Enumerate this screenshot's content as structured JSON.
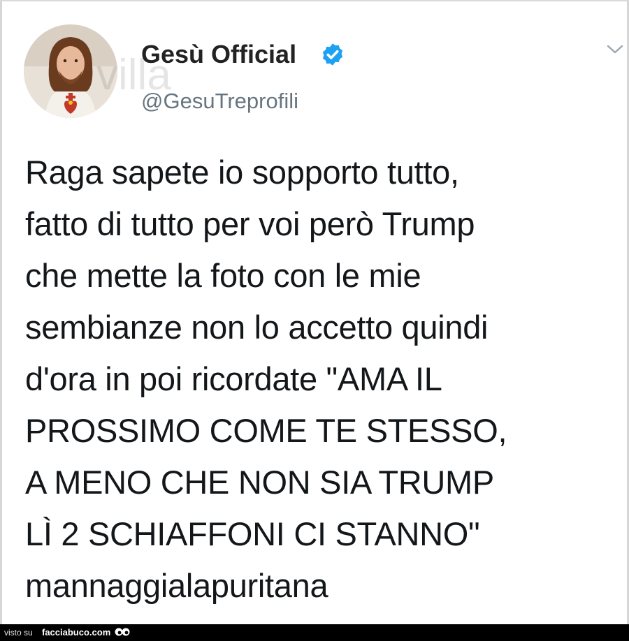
{
  "tweet": {
    "display_name": "Gesù Official",
    "verified_icon": "verified-badge-icon",
    "handle": "@GesuTreprofili",
    "menu_icon": "chevron-down-icon",
    "text_lines": [
      "Raga sapete io sopporto tutto,",
      "fatto di tutto per voi però Trump",
      "che mette la foto con le mie",
      "sembianze non lo accetto quindi",
      "d'ora in poi ricordate \"AMA IL",
      "PROSSIMO COME TE STESSO,",
      "A MENO CHE NON SIA TRUMP",
      "LÌ 2 SCHIAFFONI CI STANNO\"",
      "mannaggialapuritana"
    ]
  },
  "watermark": "villa",
  "footer": {
    "prefix": "visto su",
    "site": "facciabuco.com"
  },
  "colors": {
    "verified_blue": "#1da1f2",
    "handle_gray": "#66757f",
    "text": "#14171a"
  }
}
